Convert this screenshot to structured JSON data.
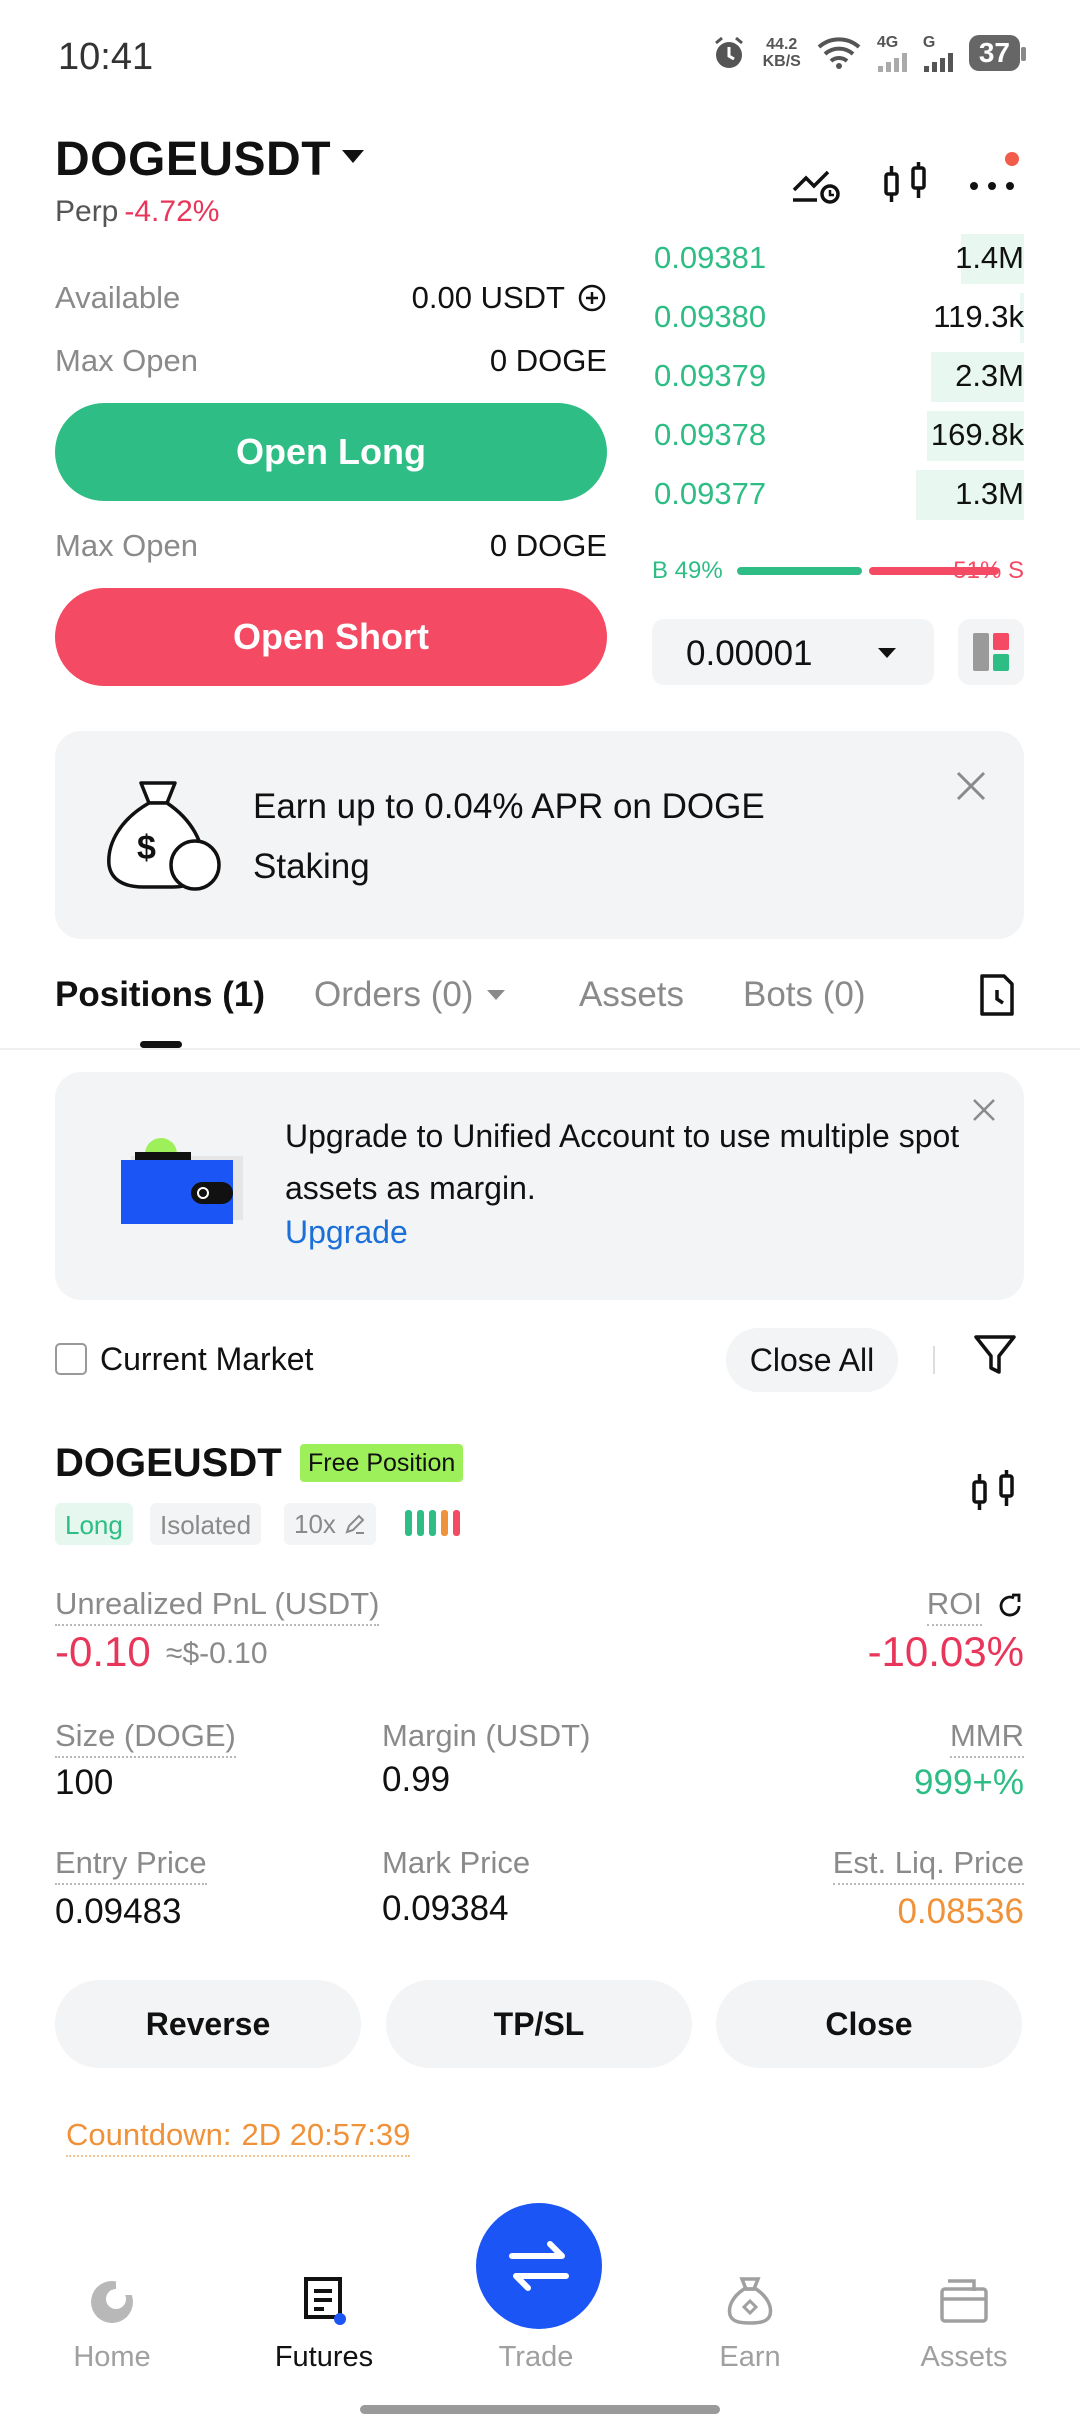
{
  "status_bar": {
    "time": "10:41",
    "net_speed_value": "44.2",
    "net_speed_unit": "KB/S",
    "signal1_label": "4G",
    "signal2_label": "G",
    "battery": "37"
  },
  "header": {
    "pair": "DOGEUSDT",
    "perp_label": "Perp",
    "change": "-4.72%"
  },
  "trade_panel": {
    "available_label": "Available",
    "available_value": "0.00 USDT",
    "max_open_label": "Max Open",
    "max_open_long": "0 DOGE",
    "open_long": "Open Long",
    "max_open_label_2": "Max Open",
    "max_open_short": "0 DOGE",
    "open_short": "Open Short"
  },
  "order_book": {
    "bids": [
      {
        "price": "0.09381",
        "qty": "1.4M",
        "depth": 0.17
      },
      {
        "price": "0.09380",
        "qty": "119.3k",
        "depth": 0.01
      },
      {
        "price": "0.09379",
        "qty": "2.3M",
        "depth": 0.25
      },
      {
        "price": "0.09378",
        "qty": "169.8k",
        "depth": 0.26
      },
      {
        "price": "0.09377",
        "qty": "1.3M",
        "depth": 0.29
      }
    ],
    "buy_ratio": "B 49%",
    "sell_ratio": "51% S",
    "buy_fraction": 0.49,
    "precision": "0.00001"
  },
  "promo": {
    "text": "Earn up to 0.04% APR on DOGE Staking"
  },
  "tabs": {
    "positions": "Positions (1)",
    "orders": "Orders (0)",
    "assets": "Assets",
    "bots": "Bots (0)"
  },
  "upgrade": {
    "text": "Upgrade to Unified Account to use multiple spot assets as margin.",
    "link": "Upgrade"
  },
  "filter": {
    "current_market": "Current Market",
    "close_all": "Close All"
  },
  "position": {
    "symbol": "DOGEUSDT",
    "badge": "Free Position",
    "side": "Long",
    "margin_mode": "Isolated",
    "leverage": "10x",
    "pnl_label": "Unrealized PnL (USDT)",
    "pnl_value": "-0.10",
    "pnl_approx": "≈$-0.10",
    "roi_label": "ROI",
    "roi_value": "-10.03%",
    "size_label": "Size (DOGE)",
    "size_value": "100",
    "margin_label": "Margin (USDT)",
    "margin_value": "0.99",
    "mmr_label": "MMR",
    "mmr_value": "999+%",
    "entry_label": "Entry Price",
    "entry_value": "0.09483",
    "mark_label": "Mark Price",
    "mark_value": "0.09384",
    "liq_label": "Est. Liq. Price",
    "liq_value": "0.08536",
    "btn_reverse": "Reverse",
    "btn_tpsl": "TP/SL",
    "btn_close": "Close",
    "countdown_label": "Countdown:",
    "countdown_value": "2D 20:57:39"
  },
  "bottom_nav": {
    "home": "Home",
    "futures": "Futures",
    "trade": "Trade",
    "earn": "Earn",
    "assets": "Assets"
  },
  "colors": {
    "green": "#2ebd85",
    "red": "#f44a63",
    "orange": "#f0923a",
    "blue": "#1c55f5",
    "link": "#1b6fd8"
  }
}
